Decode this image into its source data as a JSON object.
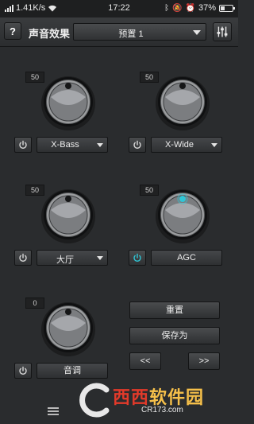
{
  "status_bar": {
    "speed": "1.41K/s",
    "time": "17:22",
    "battery": "37%",
    "battery_level": 0.37
  },
  "toolbar": {
    "help_label": "?",
    "title": "声音效果",
    "preset": "预置 1"
  },
  "effects": [
    {
      "value": "50",
      "label": "X-Bass",
      "kind": "select",
      "enabled": false
    },
    {
      "value": "50",
      "label": "X-Wide",
      "kind": "select",
      "enabled": false
    },
    {
      "value": "50",
      "label": "大厅",
      "kind": "select",
      "enabled": false
    },
    {
      "value": "50",
      "label": "AGC",
      "kind": "button",
      "enabled": true
    },
    {
      "value": "0",
      "label": "音调",
      "kind": "button",
      "enabled": false
    }
  ],
  "actions": {
    "reset": "重置",
    "save_as": "保存为",
    "prev": "<<",
    "next": ">>"
  },
  "watermark": {
    "brand_a": "西西",
    "brand_b": "软件园",
    "domain": "CR173.com"
  },
  "colors": {
    "accent": "#2fc6d6",
    "background": "#2a2c2e"
  }
}
